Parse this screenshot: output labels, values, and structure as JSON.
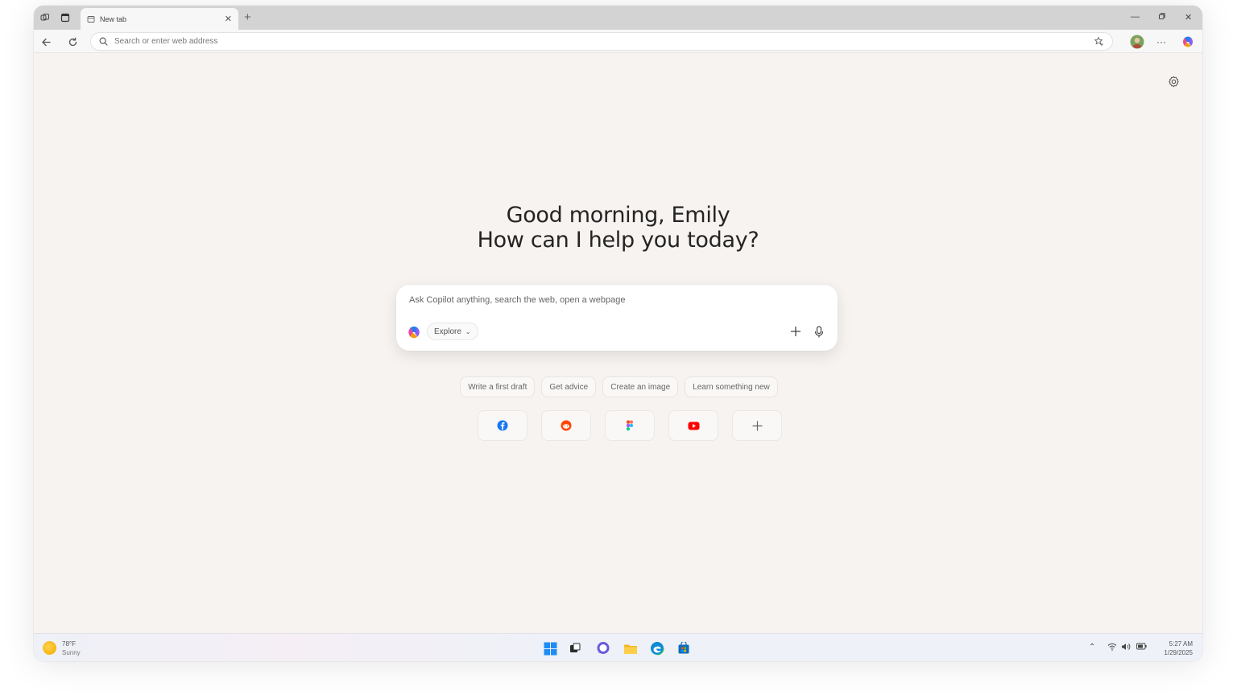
{
  "tab": {
    "title": "New tab"
  },
  "addressbar": {
    "placeholder": "Search or enter web address"
  },
  "greeting": {
    "line1": "Good morning, Emily",
    "line2": "How can I help you today?"
  },
  "composer": {
    "placeholder": "Ask Copilot anything, search the web, open a webpage",
    "mode_label": "Explore"
  },
  "suggestions": [
    "Write a first draft",
    "Get advice",
    "Create an image",
    "Learn something new"
  ],
  "quick_links": [
    {
      "name": "facebook-icon",
      "color": "#1877f2"
    },
    {
      "name": "reddit-icon",
      "color": "#ff4500"
    },
    {
      "name": "figma-icon",
      "color": "#f24e1e"
    },
    {
      "name": "youtube-icon",
      "color": "#ff0000"
    },
    {
      "name": "plus-icon",
      "color": "#666666"
    }
  ],
  "taskbar": {
    "weather_temp": "78°F",
    "weather_condition": "Sunny",
    "clock_time": "5:27 AM",
    "clock_date": "1/29/2025"
  },
  "colors": {
    "page_background": "#f7f3f1",
    "titlebar": "#d3d3d3",
    "accent": "#0078d4"
  }
}
